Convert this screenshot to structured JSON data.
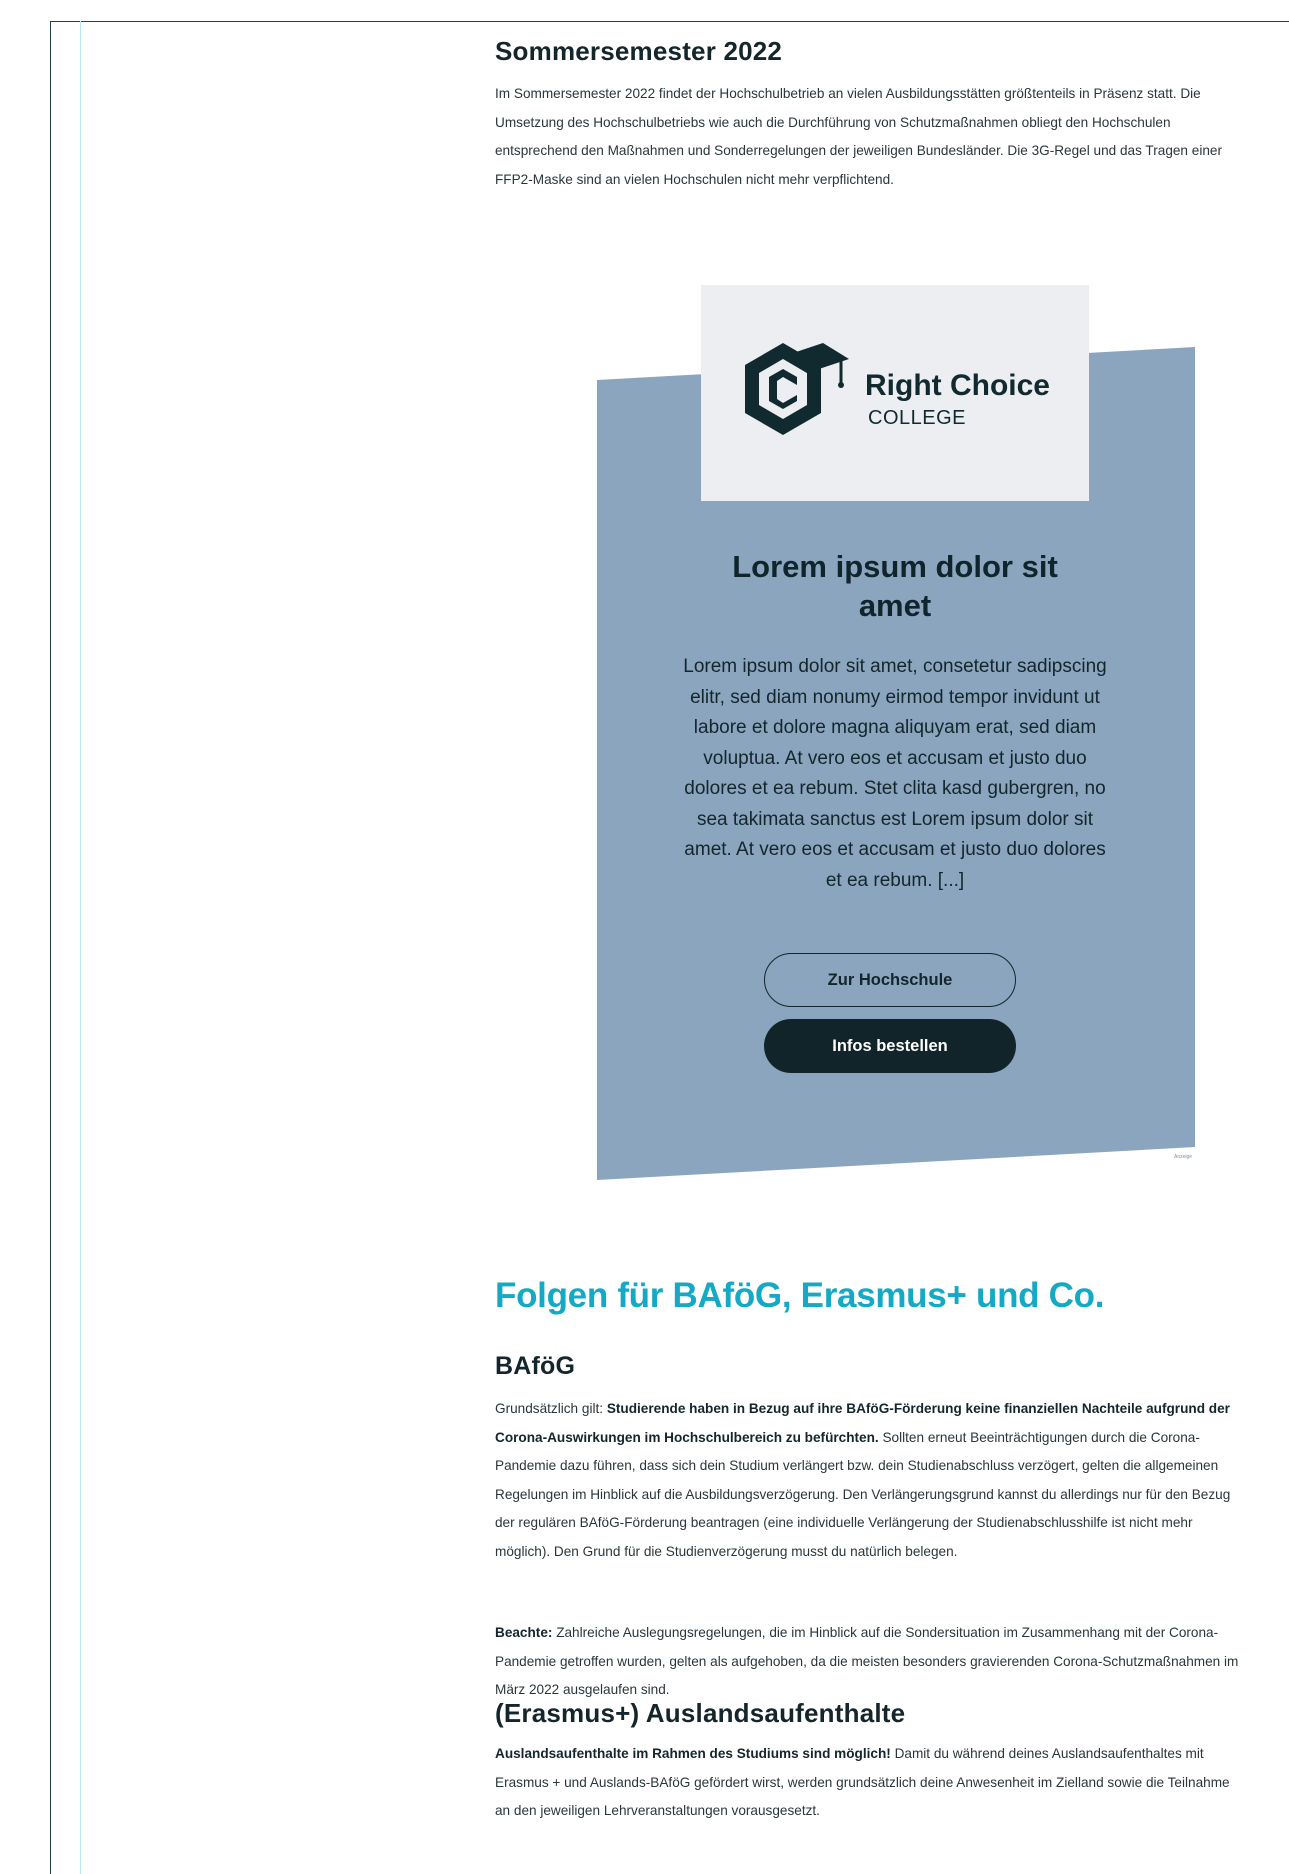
{
  "sommersemester": {
    "title": "Sommersemester 2022",
    "text": "Im Sommersemester 2022 findet der Hochschulbetrieb an vielen Ausbildungsstätten größtenteils in Präsenz statt. Die Umsetzung des Hochschulbetriebs wie auch die Durchführung von Schutzmaßnahmen obliegt den Hochschulen entsprechend den Maßnahmen und Sonderregelungen der jeweiligen Bundesländer. Die 3G-Regel und das Tragen einer FFP2-Maske sind an vielen Hochschulen nicht mehr verpflichtend."
  },
  "ad": {
    "logo_name": "Right Choice",
    "logo_sub": "COLLEGE",
    "title": "Lorem ipsum dolor sit amet",
    "text": "Lorem ipsum dolor sit amet, consetetur sadipscing elitr, sed diam nonumy eirmod tempor invidunt ut labore et dolore magna aliquyam erat, sed diam voluptua. At vero eos et accusam et justo duo dolores et ea rebum. Stet clita kasd gubergren, no sea takimata sanctus est Lorem ipsum dolor sit amet. At vero eos et accusam et justo duo dolores et ea rebum. [...]",
    "button_outline": "Zur Hochschule",
    "button_solid": "Infos bestellen",
    "tag": "Anzeige",
    "colors": {
      "panel": "#8ba5bf",
      "logo_box": "#eceef1",
      "dark": "#102429"
    }
  },
  "folgen": {
    "title": "Folgen für BAföG, Erasmus+ und Co.",
    "color": "#14a9c4"
  },
  "bafoeg": {
    "title": "BAföG",
    "intro": "Grundsätzlich gilt: ",
    "bold": "Studierende haben in Bezug auf ihre BAföG-Förderung keine finanziellen Nachteile aufgrund der Corona-Auswirkungen im Hochschulbereich zu befürchten.",
    "rest": " Sollten erneut Beeinträchtigungen durch die Corona-Pandemie dazu führen, dass sich dein Studium verlängert bzw. dein Studienabschluss verzögert, gelten die allgemeinen Regelungen im Hinblick auf die Ausbildungsverzögerung. Den Verlängerungsgrund kannst du allerdings nur für den Bezug der regulären BAföG-Förderung beantragen (eine individuelle Verlängerung der Studienabschlusshilfe ist nicht mehr möglich). Den Grund für die Studienverzögerung musst du natürlich belegen."
  },
  "beachte": {
    "label": "Beachte:",
    "text": " Zahlreiche Auslegungsregelungen, die im Hinblick auf die Sondersituation im Zusammenhang mit der Corona-Pandemie getroffen wurden, gelten als aufgehoben, da die meisten besonders gravierenden Corona-Schutzmaßnahmen im März 2022 ausgelaufen sind."
  },
  "erasmus": {
    "title": "(Erasmus+) Auslandsaufenthalte",
    "bold": "Auslandsaufenthalte im Rahmen des Studiums sind möglich!",
    "text": " Damit du während deines Auslandsaufenthaltes mit Erasmus + und Auslands-BAföG gefördert wirst, werden grundsätzlich deine Anwesenheit im Zielland sowie die Teilnahme an den jeweiligen Lehrveranstaltungen vorausgesetzt."
  }
}
